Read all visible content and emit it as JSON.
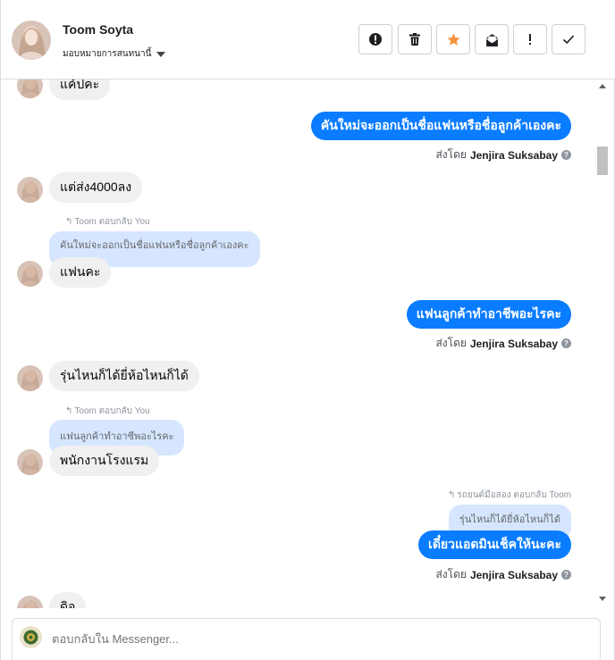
{
  "header": {
    "contact_name": "Toom Soyta",
    "assign_label": "มอบหมายการสนทนานี้",
    "toolbar": {
      "spam_icon": "alert-circle-icon",
      "delete_icon": "trash-icon",
      "star_icon": "star-icon",
      "unread_icon": "mail-icon",
      "important_icon": "exclamation-icon",
      "done_icon": "check-icon"
    }
  },
  "messages": {
    "m1": {
      "text": "แค้ปคะ"
    },
    "m2": {
      "text": "คันใหม่จะออกเป็นชื่อแฟนหรือชื่อลูกค้าเองคะ",
      "sent_by_prefix": "ส่งโดย",
      "sent_by_name": "Jenjira Suksabay"
    },
    "m3": {
      "text": "แต่ส่ง4000ลง"
    },
    "m4": {
      "reply_label": "Toom ตอบกลับ You",
      "quote": "คันใหม่จะออกเป็นชื่อแฟนหรือชื่อลูกค้าเองคะ",
      "text": "แฟนคะ"
    },
    "m5": {
      "text": "แฟนลูกค้าทำอาชีพอะไรคะ",
      "sent_by_prefix": "ส่งโดย",
      "sent_by_name": "Jenjira Suksabay"
    },
    "m6": {
      "text": "รุ่นไหนก็ได้ยี่ห้อไหนก็ได้"
    },
    "m7": {
      "reply_label": "Toom ตอบกลับ You",
      "quote": "แฟนลูกค้าทำอาชีพอะไรคะ",
      "text": "พนักงานโรงแรม"
    },
    "m8": {
      "reply_label": "รถยนต์มือสอง ตอบกลับ Toom",
      "quote": "รุ่นไหนก็ได้ยี่ห้อไหนก็ได้",
      "text": "เดี๋ยวแอดมินเช็คให้นะคะ",
      "sent_by_prefix": "ส่งโดย",
      "sent_by_name": "Jenjira Suksabay"
    },
    "m9": {
      "text": "ดิจ"
    }
  },
  "composer": {
    "placeholder": "ตอบกลับใน Messenger..."
  },
  "colors": {
    "outgoing_bubble": "#0a7cff",
    "incoming_bubble": "#f0f0f0",
    "quote_bubble": "#d6e6ff",
    "star": "#f5923e"
  }
}
